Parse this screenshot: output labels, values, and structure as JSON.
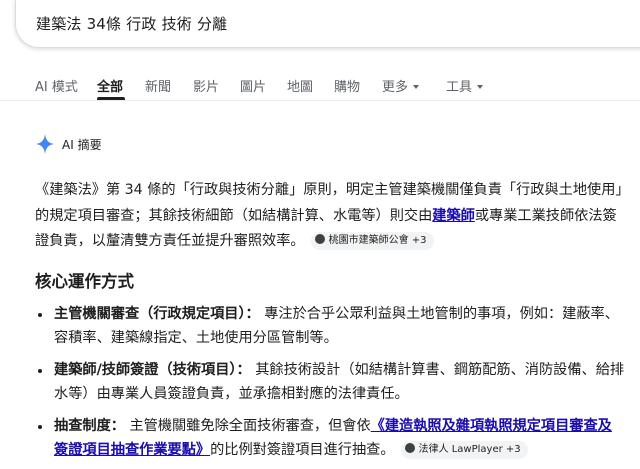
{
  "search": {
    "query": "建築法 34條 行政 技術 分離"
  },
  "tabs": [
    {
      "label": "AI 模式"
    },
    {
      "label": "全部"
    },
    {
      "label": "新聞"
    },
    {
      "label": "影片"
    },
    {
      "label": "圖片"
    },
    {
      "label": "地圖"
    },
    {
      "label": "購物"
    },
    {
      "label": "更多"
    },
    {
      "label": "工具"
    }
  ],
  "active_tab": "全部",
  "ai_overview": {
    "title": "AI 摘要",
    "intro": {
      "before_link": "《建築法》第 34 條的「行政與技術分離」原則，明定主管建築機關僅負責「行政與土地使用」的規定項目審查；其餘技術細節（如結構計算、水電等）則交由",
      "link": "建築師",
      "after_link": "或專業工業技師依法簽證負責，以釐清雙方責任並提升審照效率。",
      "source_chip": "桃園市建築師公會 +3"
    },
    "section_title": "核心運作方式",
    "bullets": [
      {
        "heading": "主管機關審查（行政規定項目）：",
        "text": "專注於合乎公眾利益與土地管制的事項，例如：建蔽率、容積率、建築線指定、土地使用分區管制等。"
      },
      {
        "heading": "建築師/技師簽證（技術項目）：",
        "text": "其餘技術設計（如結構計算書、鋼筋配筋、消防設備、給排水等）由專業人員簽證負責，並承擔相對應的法律責任。"
      },
      {
        "heading": "抽查制度：",
        "text_before_link": "主管機關雖免除全面技術審查，但會依",
        "link": "《建造執照及雜項執照規定項目審查及簽證項目抽查作業要點》",
        "text_after_link": "的比例對簽證項目進行抽查。",
        "source_chip": "法律人 LawPlayer +3"
      }
    ]
  },
  "colors": {
    "link": "#1a0dab",
    "text": "#1f1f1f",
    "muted": "#5f6368",
    "sparkle": "#4285f4"
  }
}
